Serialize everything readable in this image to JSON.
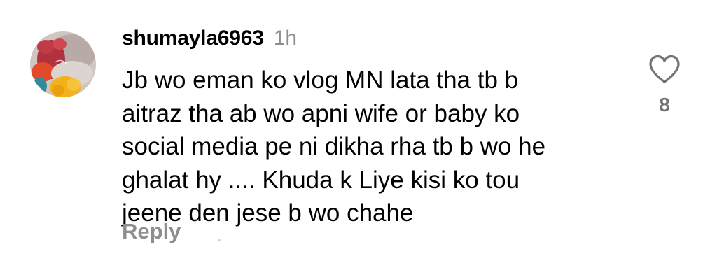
{
  "comment": {
    "avatar_icon": "user-avatar",
    "username": "shumayla6963",
    "time": "1h",
    "text": "Jb wo eman ko vlog MN lata tha tb b\naitraz tha ab wo apni wife or baby ko\nsocial media pe ni dikha rha tb b wo he\nghalat hy .... Khuda k Liye kisi ko tou\njeene den jese b wo chahe",
    "reply_label": "Reply",
    "like_icon": "heart-icon",
    "like_count": "8"
  },
  "colors": {
    "text": "#000000",
    "secondary": "#8e8e8e",
    "count": "#737373",
    "background": "#ffffff"
  }
}
